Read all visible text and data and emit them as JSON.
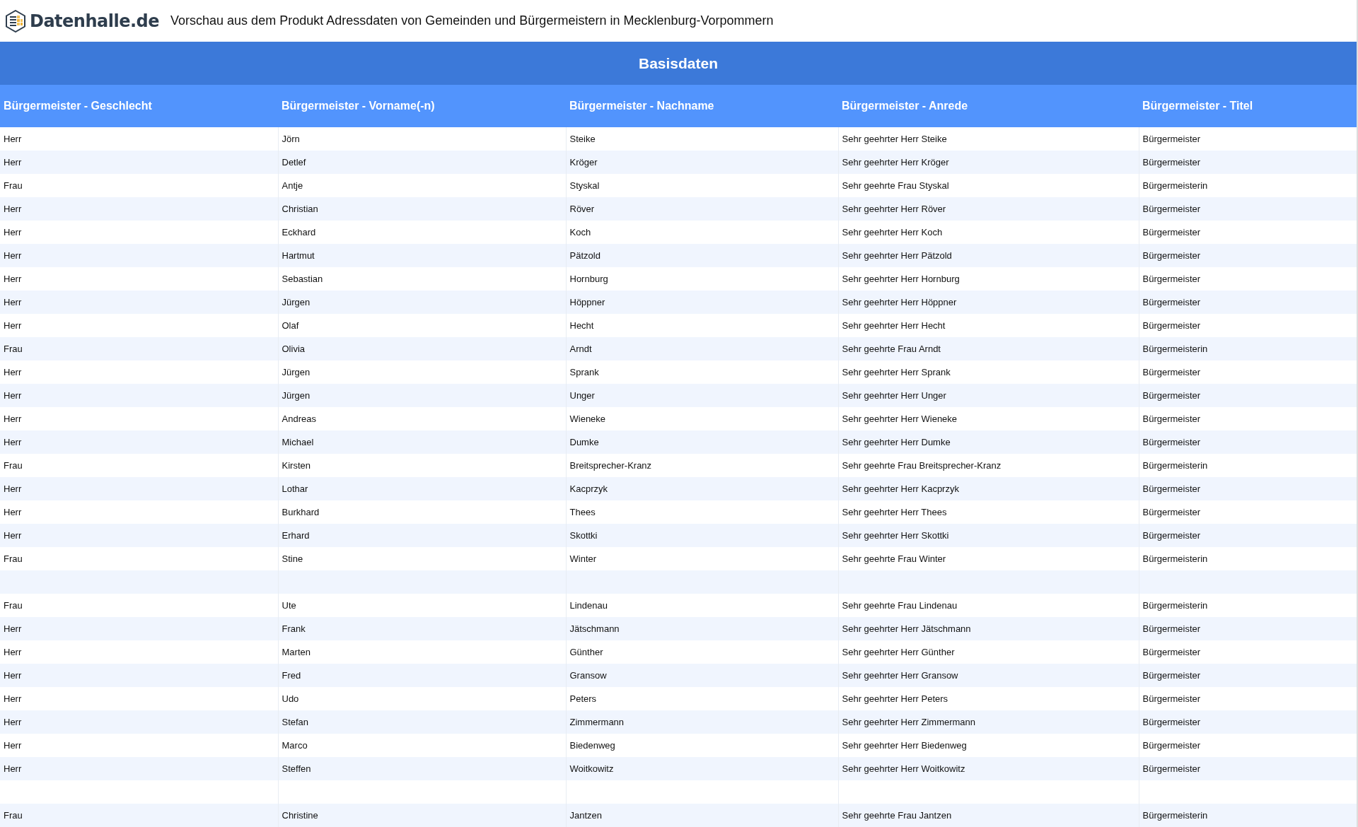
{
  "header": {
    "logo_text": "Datenhalle.de",
    "title": "Vorschau aus dem Produkt Adressdaten von Gemeinden und Bürgermeistern in Mecklenburg-Vorpommern"
  },
  "table": {
    "group_title": "Basisdaten",
    "columns": [
      "Bürgermeister - Geschlecht",
      "Bürgermeister - Vorname(-n)",
      "Bürgermeister - Nachname",
      "Bürgermeister - Anrede",
      "Bürgermeister - Titel"
    ],
    "rows": [
      {
        "cells": [
          "Herr",
          "Jörn",
          "Steike",
          "Sehr geehrter Herr Steike",
          "Bürgermeister"
        ]
      },
      {
        "cells": [
          "Herr",
          "Detlef",
          "Kröger",
          "Sehr geehrter Herr Kröger",
          "Bürgermeister"
        ]
      },
      {
        "cells": [
          "Frau",
          "Antje",
          "Styskal",
          "Sehr geehrte Frau Styskal",
          "Bürgermeisterin"
        ]
      },
      {
        "cells": [
          "Herr",
          "Christian",
          "Röver",
          "Sehr geehrter Herr Röver",
          "Bürgermeister"
        ]
      },
      {
        "cells": [
          "Herr",
          "Eckhard",
          "Koch",
          "Sehr geehrter Herr Koch",
          "Bürgermeister"
        ]
      },
      {
        "cells": [
          "Herr",
          "Hartmut",
          "Pätzold",
          "Sehr geehrter Herr Pätzold",
          "Bürgermeister"
        ]
      },
      {
        "cells": [
          "Herr",
          "Sebastian",
          "Hornburg",
          "Sehr geehrter Herr Hornburg",
          "Bürgermeister"
        ]
      },
      {
        "cells": [
          "Herr",
          "Jürgen",
          "Höppner",
          "Sehr geehrter Herr Höppner",
          "Bürgermeister"
        ]
      },
      {
        "cells": [
          "Herr",
          "Olaf",
          "Hecht",
          "Sehr geehrter Herr Hecht",
          "Bürgermeister"
        ]
      },
      {
        "cells": [
          "Frau",
          "Olivia",
          "Arndt",
          "Sehr geehrte Frau Arndt",
          "Bürgermeisterin"
        ]
      },
      {
        "cells": [
          "Herr",
          "Jürgen",
          "Sprank",
          "Sehr geehrter Herr Sprank",
          "Bürgermeister"
        ]
      },
      {
        "cells": [
          "Herr",
          "Jürgen",
          "Unger",
          "Sehr geehrter Herr Unger",
          "Bürgermeister"
        ]
      },
      {
        "cells": [
          "Herr",
          "Andreas",
          "Wieneke",
          "Sehr geehrter Herr Wieneke",
          "Bürgermeister"
        ]
      },
      {
        "cells": [
          "Herr",
          "Michael",
          "Dumke",
          "Sehr geehrter Herr Dumke",
          "Bürgermeister"
        ]
      },
      {
        "cells": [
          "Frau",
          "Kirsten",
          "Breitsprecher-Kranz",
          "Sehr geehrte Frau Breitsprecher-Kranz",
          "Bürgermeisterin"
        ]
      },
      {
        "cells": [
          "Herr",
          "Lothar",
          "Kacprzyk",
          "Sehr geehrter Herr Kacprzyk",
          "Bürgermeister"
        ]
      },
      {
        "cells": [
          "Herr",
          "Burkhard",
          "Thees",
          "Sehr geehrter Herr Thees",
          "Bürgermeister"
        ]
      },
      {
        "cells": [
          "Herr",
          "Erhard",
          "Skottki",
          "Sehr geehrter Herr Skottki",
          "Bürgermeister"
        ]
      },
      {
        "cells": [
          "Frau",
          "Stine",
          "Winter",
          "Sehr geehrte Frau Winter",
          "Bürgermeisterin"
        ]
      },
      {
        "cells": []
      },
      {
        "cells": [
          "Frau",
          "Ute",
          "Lindenau",
          "Sehr geehrte Frau Lindenau",
          "Bürgermeisterin"
        ]
      },
      {
        "cells": [
          "Herr",
          "Frank",
          "Jätschmann",
          "Sehr geehrter Herr Jätschmann",
          "Bürgermeister"
        ]
      },
      {
        "cells": [
          "Herr",
          "Marten",
          "Günther",
          "Sehr geehrter Herr Günther",
          "Bürgermeister"
        ]
      },
      {
        "cells": [
          "Herr",
          "Fred",
          "Gransow",
          "Sehr geehrter Herr Gransow",
          "Bürgermeister"
        ]
      },
      {
        "cells": [
          "Herr",
          "Udo",
          "Peters",
          "Sehr geehrter Herr Peters",
          "Bürgermeister"
        ]
      },
      {
        "cells": [
          "Herr",
          "Stefan",
          "Zimmermann",
          "Sehr geehrter Herr Zimmermann",
          "Bürgermeister"
        ]
      },
      {
        "cells": [
          "Herr",
          "Marco",
          "Biedenweg",
          "Sehr geehrter Herr Biedenweg",
          "Bürgermeister"
        ]
      },
      {
        "cells": [
          "Herr",
          "Steffen",
          "Woitkowitz",
          "Sehr geehrter Herr Woitkowitz",
          "Bürgermeister"
        ]
      },
      {
        "cells": []
      },
      {
        "cells": [
          "Frau",
          "Christine",
          "Jantzen",
          "Sehr geehrte Frau Jantzen",
          "Bürgermeisterin"
        ]
      }
    ]
  }
}
